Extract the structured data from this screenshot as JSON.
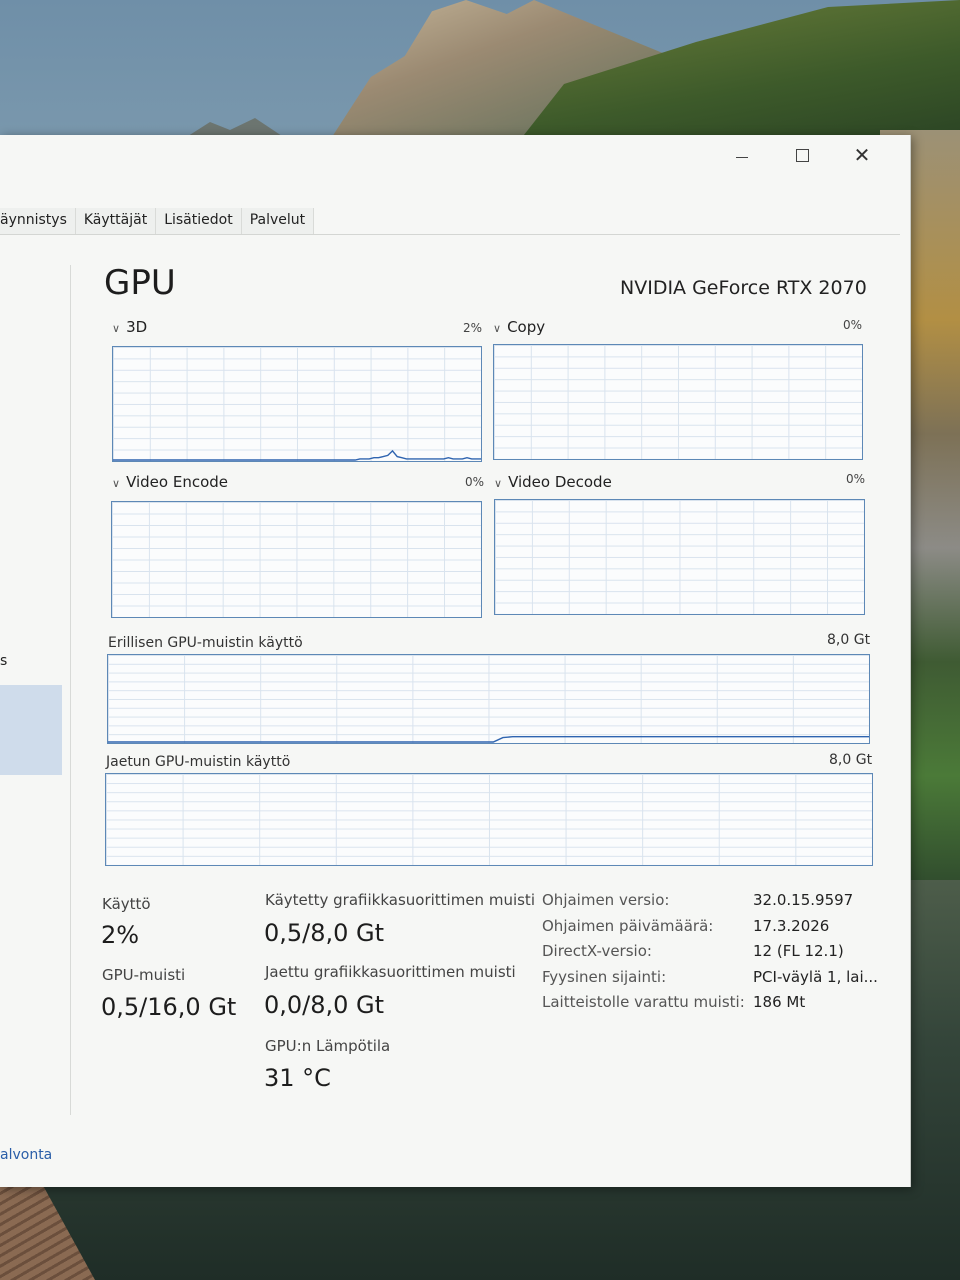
{
  "tabs": [
    {
      "label": "äynnistys"
    },
    {
      "label": "Käyttäjät"
    },
    {
      "label": "Lisätiedot"
    },
    {
      "label": "Palvelut"
    }
  ],
  "sidebar": {
    "fragment": "s",
    "bottom_link": "alvonta"
  },
  "gpu": {
    "title": "GPU",
    "model": "NVIDIA GeForce RTX 2070"
  },
  "graphs": {
    "g3d": {
      "label": "3D",
      "percent": "2%",
      "values": [
        0,
        0,
        0,
        0,
        0,
        0,
        0,
        0,
        0,
        0,
        0,
        0,
        0,
        0,
        0,
        0,
        0,
        0,
        0,
        0,
        0,
        0,
        0,
        0,
        0,
        0,
        0,
        0,
        0,
        0,
        0,
        0,
        0,
        0,
        0,
        0,
        0,
        0,
        0,
        0,
        0,
        0,
        0,
        0,
        0,
        0,
        0,
        0,
        0,
        0,
        0,
        0,
        0,
        1,
        1,
        1,
        2,
        2,
        3,
        4,
        8,
        3,
        2,
        1,
        1,
        1,
        1,
        1,
        1,
        1,
        1,
        1,
        2,
        1,
        1,
        1,
        2,
        1,
        1,
        1
      ]
    },
    "copy": {
      "label": "Copy",
      "percent": "0%",
      "values": []
    },
    "encode": {
      "label": "Video Encode",
      "percent": "0%",
      "values": []
    },
    "decode": {
      "label": "Video Decode",
      "percent": "0%",
      "values": []
    },
    "dedicated": {
      "label": "Erillisen GPU-muistin käyttö",
      "max": "8,0 Gt",
      "values": [
        0,
        0,
        0,
        0,
        0,
        0,
        0,
        0,
        0,
        0,
        0,
        0,
        0,
        0,
        0,
        0,
        0,
        0,
        0,
        0,
        0,
        0,
        0,
        0,
        0,
        0,
        0,
        0,
        0,
        0,
        0,
        0,
        0,
        0,
        0,
        0,
        0,
        0,
        0,
        0,
        0,
        5,
        6,
        6,
        6,
        6,
        6,
        6,
        6,
        6,
        6,
        6,
        6,
        6,
        6,
        6,
        6,
        6,
        6,
        6,
        6,
        6,
        6,
        6,
        6,
        6,
        6,
        6,
        6,
        6,
        6,
        6,
        6,
        6,
        6,
        6,
        6,
        6,
        6,
        6
      ]
    },
    "shared": {
      "label": "Jaetun GPU-muistin käyttö",
      "max": "8,0 Gt",
      "values": []
    }
  },
  "stats": {
    "usage": {
      "label": "Käyttö",
      "value": "2%"
    },
    "gpu_memory": {
      "label": "GPU-muisti",
      "value": "0,5/16,0 Gt"
    },
    "dedicated_memory": {
      "label": "Käytetty grafiikkasuorittimen muisti",
      "value": "0,5/8,0 Gt"
    },
    "shared_memory": {
      "label": "Jaettu grafiikkasuorittimen muisti",
      "value": "0,0/8,0 Gt"
    },
    "temperature": {
      "label": "GPU:n Lämpötila",
      "value": "31 °C"
    }
  },
  "info": [
    {
      "label": "Ohjaimen versio:",
      "value": "32.0.15.9597"
    },
    {
      "label": "Ohjaimen päivämäärä:",
      "value": "17.3.2026"
    },
    {
      "label": "DirectX-versio:",
      "value": "12 (FL 12.1)"
    },
    {
      "label": "Fyysinen sijainti:",
      "value": "PCI-väylä 1, lai..."
    },
    {
      "label": "Laitteistolle varattu muisti:",
      "value": "186 Mt"
    }
  ],
  "colors": {
    "graph_line": "#2f64b0",
    "graph_border": "#5d88b6"
  },
  "icons": {
    "minimize": "minimize-icon",
    "maximize": "maximize-icon",
    "close": "close-icon",
    "chevron": "chevron-down-icon"
  }
}
